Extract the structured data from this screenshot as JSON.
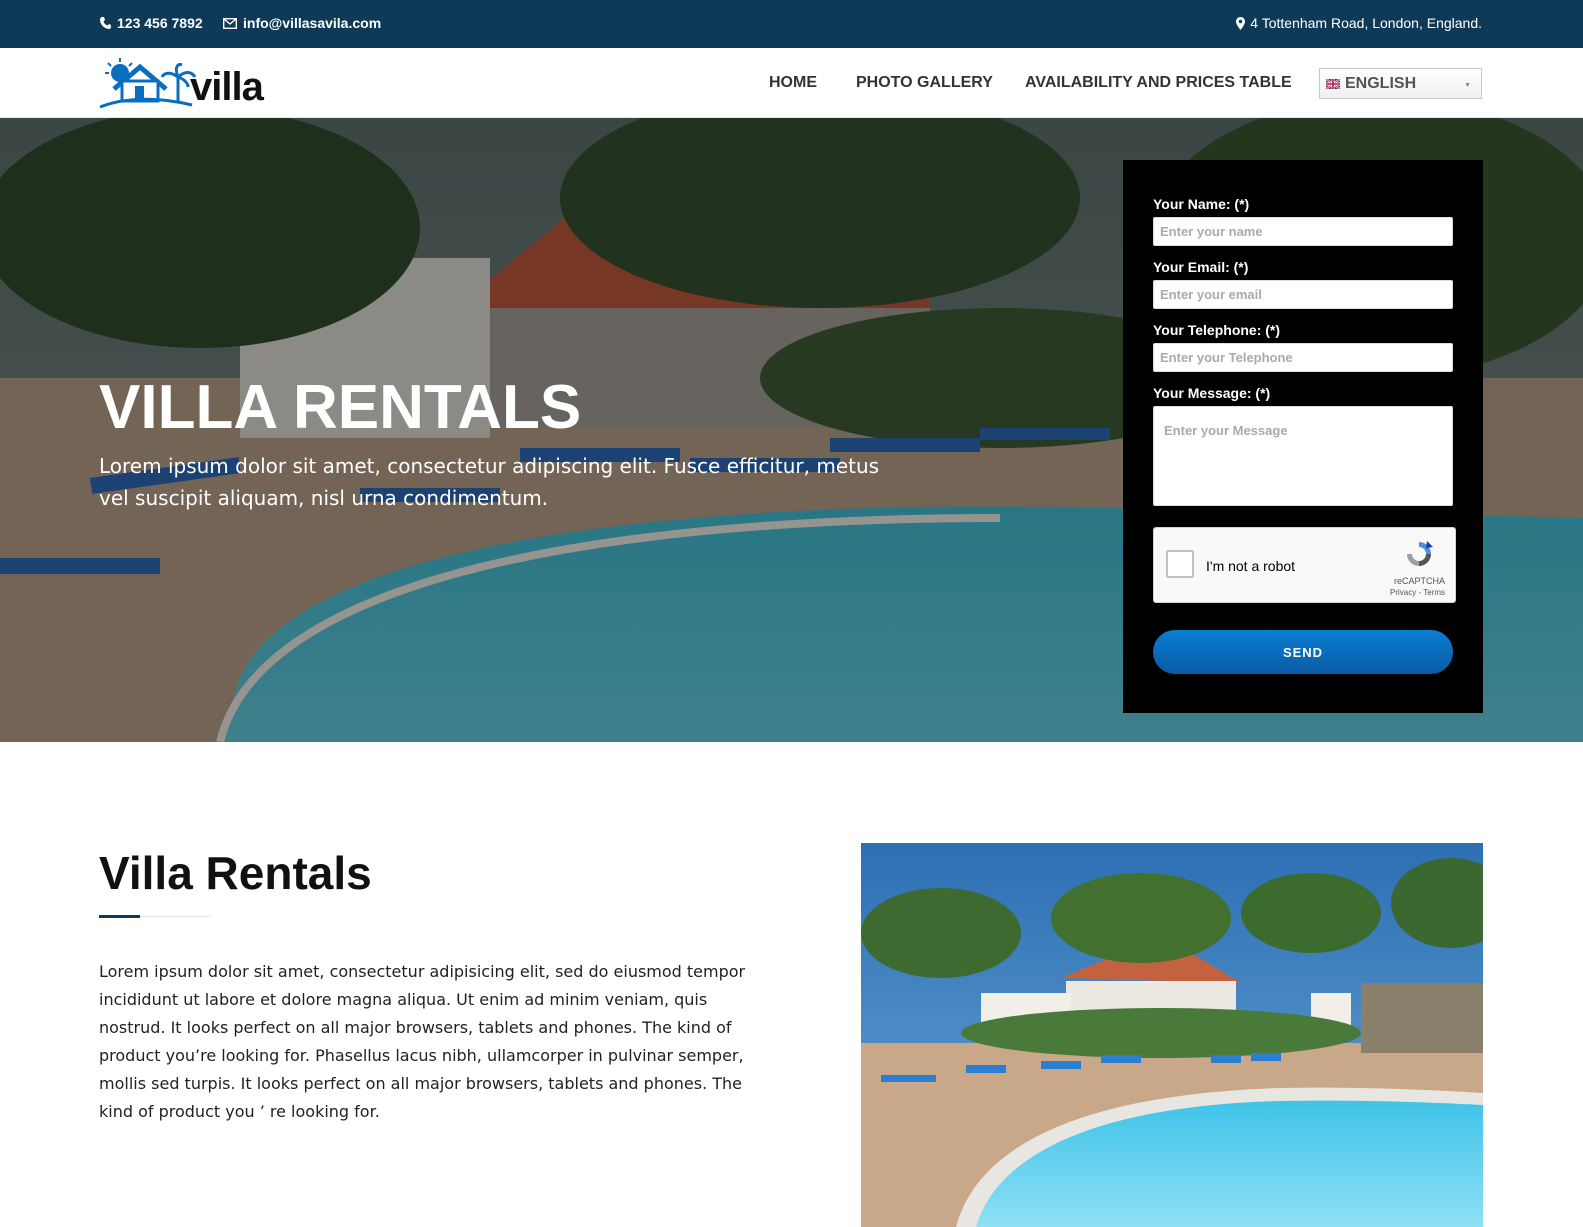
{
  "topbar": {
    "phone": "123 456 7892",
    "email": "info@villasavila.com",
    "address": "4 Tottenham Road, London, England."
  },
  "header": {
    "logo_text": "villa",
    "nav": [
      "HOME",
      "PHOTO GALLERY",
      "AVAILABILITY AND PRICES TABLE"
    ],
    "language": "ENGLISH"
  },
  "hero": {
    "title": "VILLA RENTALS",
    "text": "Lorem ipsum dolor sit amet, consectetur adipiscing elit. Fusce efficitur, metus vel suscipit aliquam, nisl urna condimentum."
  },
  "form": {
    "name_label": "Your Name: (*)",
    "name_placeholder": "Enter your name",
    "email_label": "Your Email: (*)",
    "email_placeholder": "Enter your email",
    "phone_label": "Your Telephone: (*)",
    "phone_placeholder": "Enter your Telephone",
    "message_label": "Your Message: (*)",
    "message_placeholder": "Enter your Message",
    "captcha_label": "I'm not a robot",
    "captcha_brand": "reCAPTCHA",
    "captcha_terms": "Privacy - Terms",
    "send_label": "SEND"
  },
  "section": {
    "title": "Villa Rentals",
    "text": "Lorem ipsum dolor sit amet, consectetur adipisicing elit, sed do eiusmod tempor incididunt ut labore et dolore magna aliqua. Ut enim ad minim veniam, quis nostrud. It looks perfect on all major browsers, tablets and phones. The kind of product you’re looking for. Phasellus lacus nibh, ullamcorper in pulvinar semper, mollis sed turpis. It looks perfect on all major browsers, tablets and phones. The kind of product you ’ re looking for."
  },
  "colors": {
    "topbar": "#0f3a57",
    "accent": "#0a6ec0",
    "form_bg": "#000000"
  },
  "icons": [
    "phone-icon",
    "envelope-icon",
    "map-pin-icon",
    "uk-flag-icon",
    "recaptcha-icon"
  ]
}
